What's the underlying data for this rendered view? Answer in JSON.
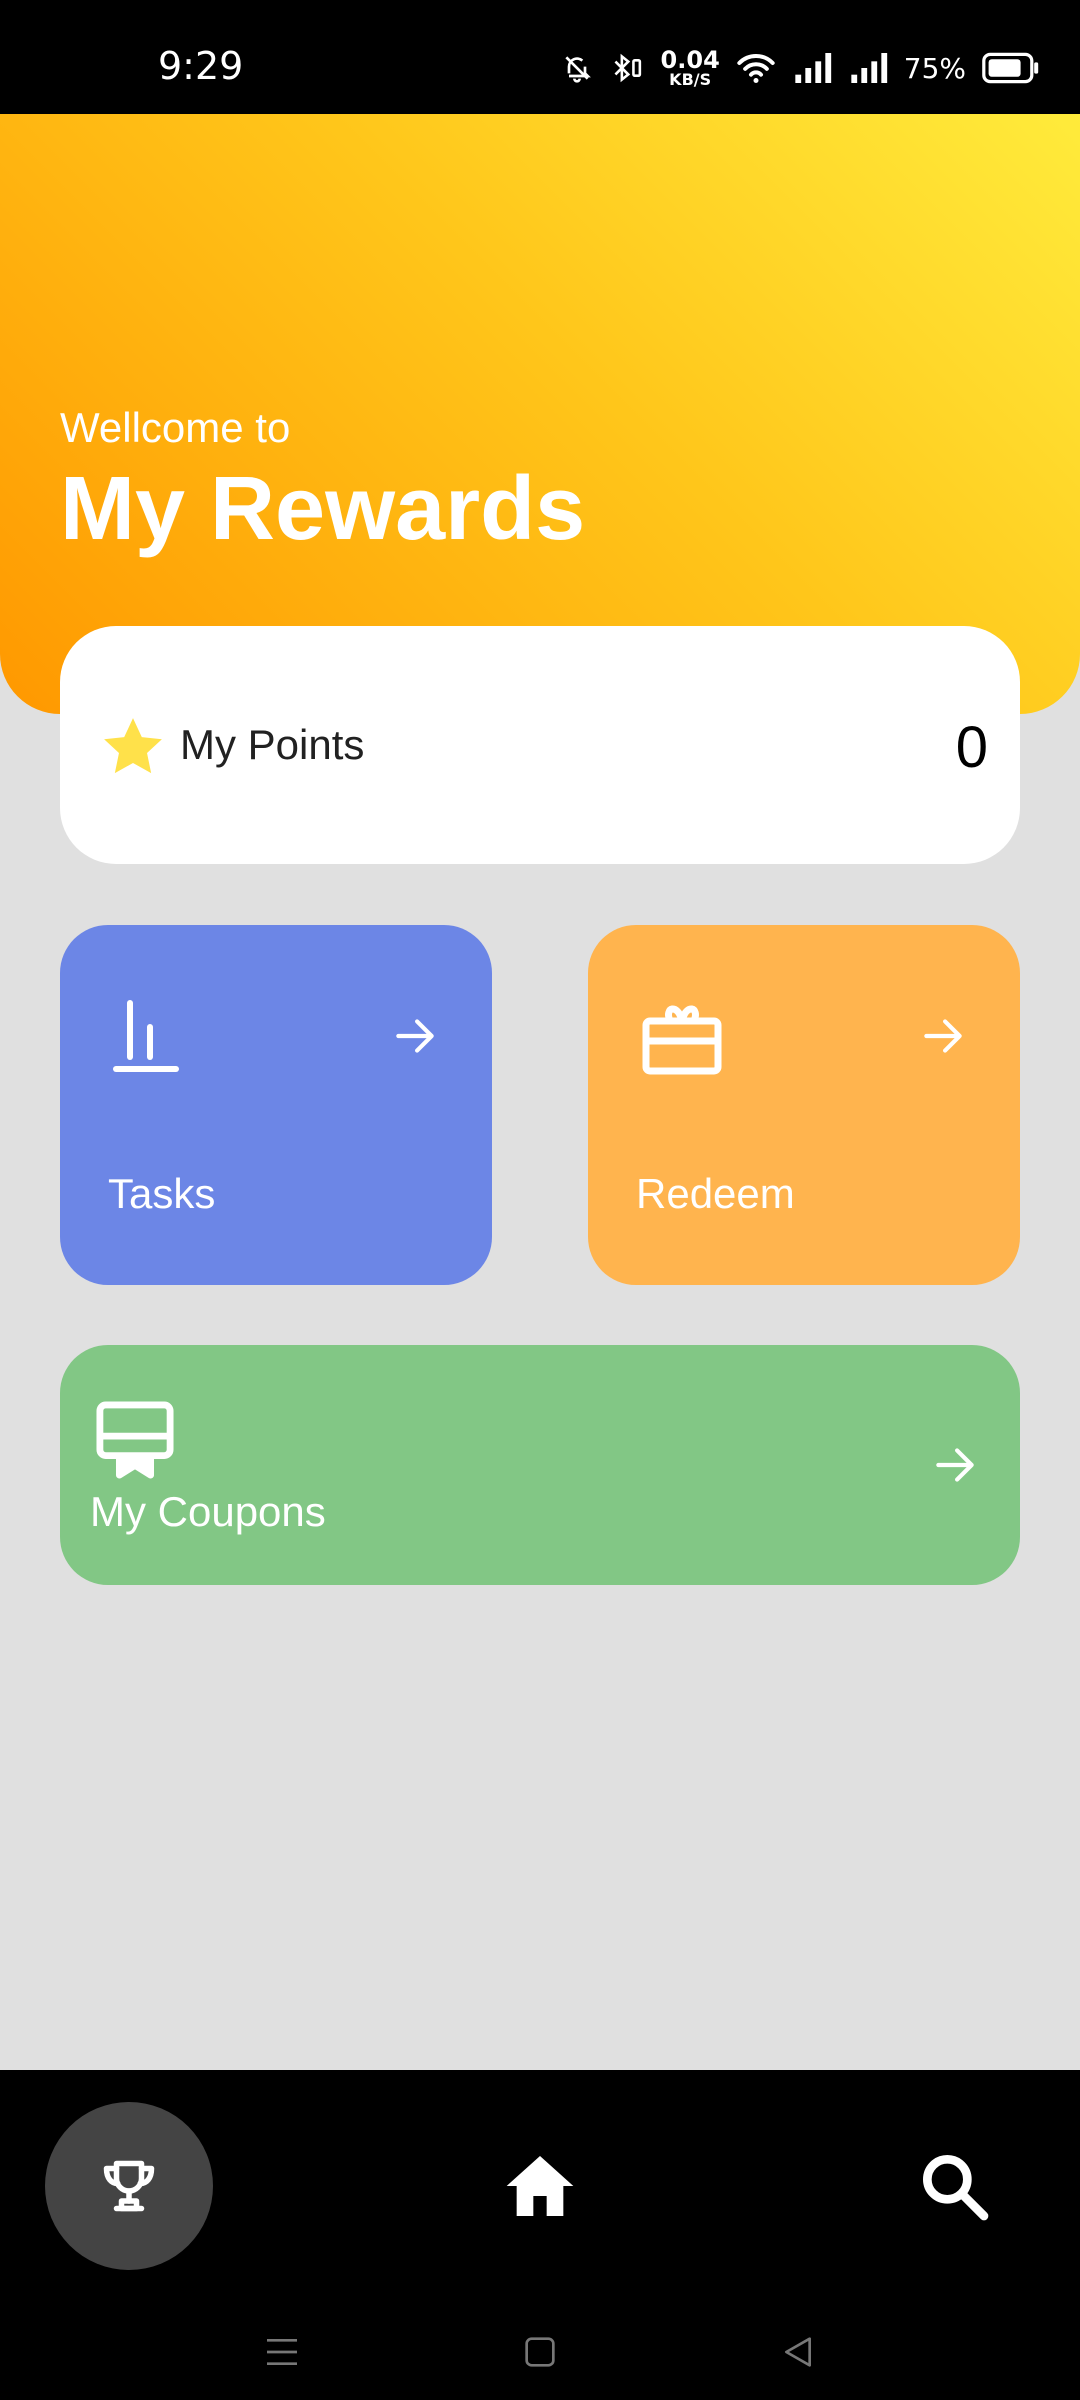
{
  "status_bar": {
    "time": "9:29",
    "net_speed_value": "0.04",
    "net_speed_unit": "KB/S",
    "battery_percent": "75%",
    "icons": [
      "mute-bell-icon",
      "bluetooth-icon",
      "wifi-icon",
      "signal-icon",
      "signal-icon",
      "battery-icon"
    ]
  },
  "header": {
    "subtitle": "Wellcome to",
    "title": "My Rewards",
    "gradient": [
      "#ffeb3b",
      "#ff9800"
    ]
  },
  "points": {
    "label": "My Points",
    "value": "0",
    "icon": "star-icon",
    "star_color": "#ffe14a"
  },
  "tiles": {
    "tasks": {
      "label": "Tasks",
      "icon": "bar-chart-icon",
      "color": "#6c86e6"
    },
    "redeem": {
      "label": "Redeem",
      "icon": "gift-card-icon",
      "color": "#ffb44e"
    },
    "coupons": {
      "label": "My Coupons",
      "icon": "coupon-icon",
      "color": "#82c785"
    }
  },
  "bottom_nav": {
    "items": [
      "trophy-icon",
      "home-icon",
      "search-icon"
    ],
    "active": "trophy-icon"
  },
  "system_nav": [
    "menu-icon",
    "home-square-icon",
    "back-icon"
  ]
}
